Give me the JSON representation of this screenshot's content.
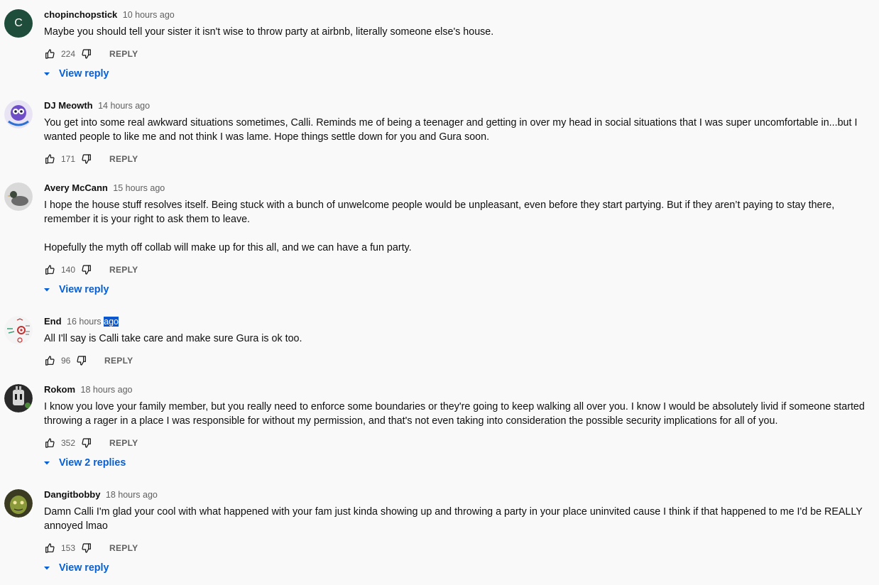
{
  "comments": [
    {
      "author": "chopinchopstick",
      "time": "10 hours ago",
      "avatar_letter": "C",
      "text": "Maybe you should tell your sister it isn't wise to throw party at airbnb, literally someone else's house.",
      "likes": "224",
      "reply_label": "REPLY",
      "view_replies": "View reply"
    },
    {
      "author": "DJ Meowth",
      "time": "14 hours ago",
      "text": "You get into some real awkward situations sometimes, Calli. Reminds me of being a teenager and getting in over my head in social situations that I was super uncomfortable in...but I wanted people to like me and not think I was lame. Hope things settle down for you and Gura soon.",
      "likes": "171",
      "reply_label": "REPLY"
    },
    {
      "author": "Avery McCann",
      "time": "15 hours ago",
      "text": "I hope the house stuff resolves itself. Being stuck with a bunch of unwelcome people would be unpleasant, even before they start partying. But if they aren’t paying to stay there, remember it is your right to ask them to leave.\n\nHopefully the myth off collab will make up for this all, and we can have a fun party.",
      "likes": "140",
      "reply_label": "REPLY",
      "view_replies": "View reply"
    },
    {
      "author": "End",
      "time_prefix": "16 hours ",
      "time_selected": "ago",
      "text": "All I'll say is Calli take care and make sure Gura is ok too.",
      "likes": "96",
      "reply_label": "REPLY"
    },
    {
      "author": "Rokom",
      "time": "18 hours ago",
      "text": "I know you love your family member, but you really need to enforce some boundaries or they're going to keep walking all over you. I know I would be absolutely livid if someone started throwing a rager in a place I was responsible for without my permission, and that's not even taking into consideration the possible security implications for all of you.",
      "likes": "352",
      "reply_label": "REPLY",
      "view_replies": "View 2 replies"
    },
    {
      "author": "Dangitbobby",
      "time": "18 hours ago",
      "text": "Damn Calli I'm glad your cool with what happened with your fam just kinda showing up and throwing a party in your place uninvited cause I think if that happened to me I'd be REALLY annoyed lmao",
      "likes": "153",
      "reply_label": "REPLY",
      "view_replies": "View reply"
    }
  ],
  "colors": {
    "background": "#f9f9f9",
    "link_blue": "#065fd4",
    "meta_gray": "#606060",
    "selection": "#0b57d0"
  }
}
